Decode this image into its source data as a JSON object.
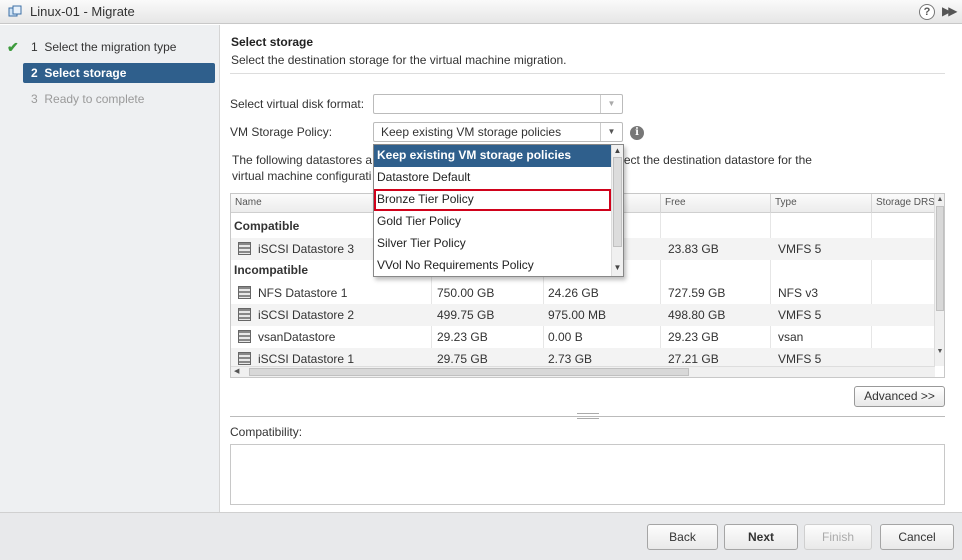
{
  "window": {
    "title": "Linux-01 - Migrate",
    "help_glyph": "?",
    "expand_glyph": "▶▶"
  },
  "steps": [
    {
      "number": "1",
      "label": "Select the migration type",
      "state": "done"
    },
    {
      "number": "2",
      "label": "Select storage",
      "state": "active"
    },
    {
      "number": "3",
      "label": "Ready to complete",
      "state": "pending"
    }
  ],
  "section": {
    "title": "Select storage",
    "subtitle": "Select the destination storage for the virtual machine migration."
  },
  "disk_format": {
    "label": "Select virtual disk format:",
    "value": ""
  },
  "storage_policy": {
    "label": "VM Storage Policy:",
    "value": "Keep existing VM storage policies"
  },
  "description": {
    "part1": "The following datastores a",
    "part2": "at you selected. Select the destination datastore for the",
    "line2": "virtual machine configurati"
  },
  "grid": {
    "columns": [
      "Name",
      "",
      "",
      "Free",
      "Type",
      "Storage DRS"
    ],
    "groups": {
      "compatible": "Compatible",
      "incompatible": "Incompatible"
    },
    "compatible_rows": [
      {
        "name": "iSCSI Datastore 3",
        "capacity": "",
        "provisioned": "",
        "free": "23.83 GB",
        "type": "VMFS 5"
      }
    ],
    "incompatible_rows": [
      {
        "name": "NFS Datastore 1",
        "capacity": "750.00 GB",
        "provisioned": "24.26 GB",
        "free": "727.59 GB",
        "type": "NFS v3"
      },
      {
        "name": "iSCSI Datastore 2",
        "capacity": "499.75 GB",
        "provisioned": "975.00 MB",
        "free": "498.80 GB",
        "type": "VMFS 5"
      },
      {
        "name": "vsanDatastore",
        "capacity": "29.23 GB",
        "provisioned": "0.00 B",
        "free": "29.23 GB",
        "type": "vsan"
      },
      {
        "name": "iSCSI Datastore 1",
        "capacity": "29.75 GB",
        "provisioned": "2.73 GB",
        "free": "27.21 GB",
        "type": "VMFS 5"
      }
    ]
  },
  "dropdown_options": [
    "Keep existing VM storage policies",
    "Datastore Default",
    "Bronze Tier Policy",
    "Gold Tier Policy",
    "Silver Tier Policy",
    "VVol No Requirements Policy"
  ],
  "advanced_label": "Advanced >>",
  "compatibility_label": "Compatibility:",
  "buttons": {
    "back": "Back",
    "next": "Next",
    "finish": "Finish",
    "cancel": "Cancel"
  },
  "colors": {
    "accent": "#2f5f8c",
    "highlight_border": "#d0021b",
    "check": "#3d9b3d"
  }
}
